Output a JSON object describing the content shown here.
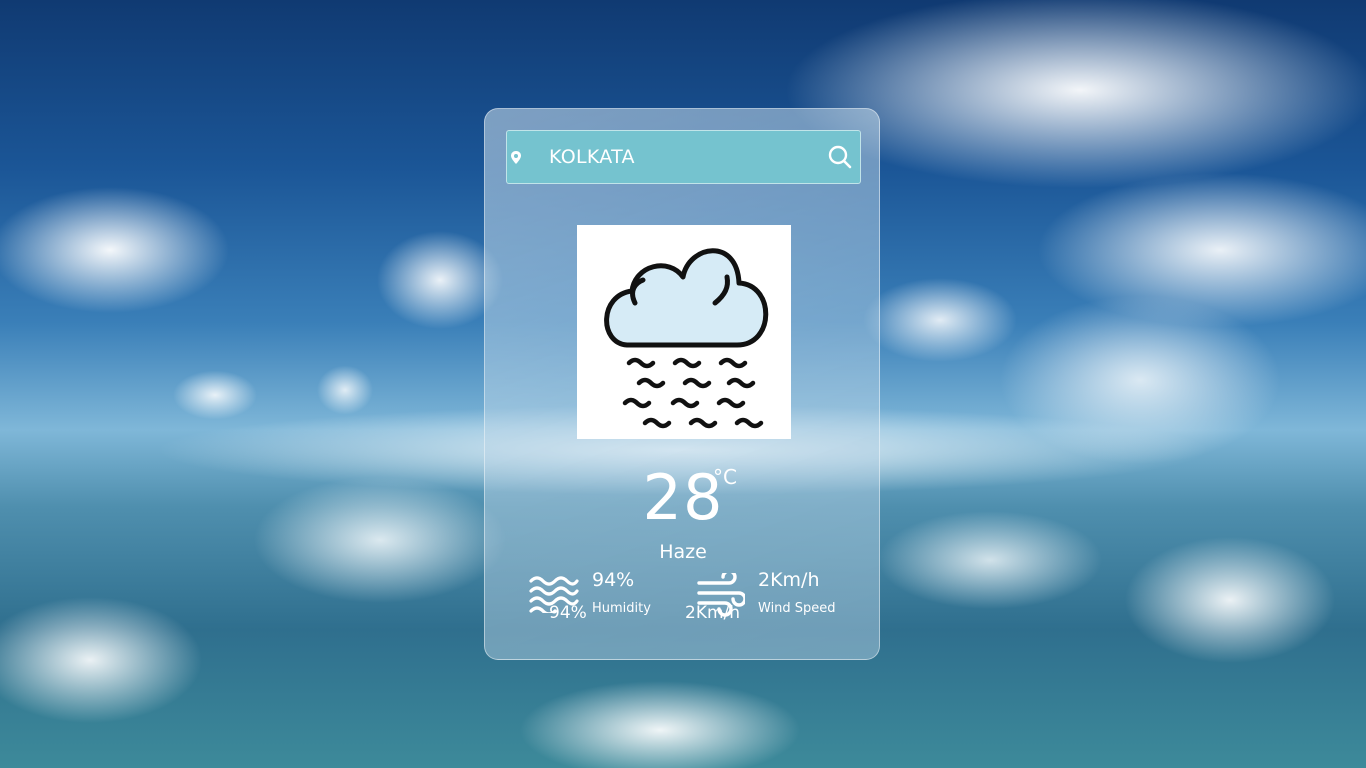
{
  "search": {
    "value": "KOLKATA"
  },
  "weather": {
    "temperature": "28",
    "unit": "°C",
    "condition": "Haze",
    "icon": "haze-cloud-icon"
  },
  "details": {
    "humidity": {
      "value": "94%",
      "label": "Humidity",
      "icon": "humidity-waves-icon"
    },
    "wind": {
      "value": "2Km/h",
      "label": "Wind Speed",
      "icon": "wind-icon"
    }
  },
  "colors": {
    "search_bar": "#75c3cf",
    "text": "#ffffff",
    "cloud_fill": "#d6ebf6"
  }
}
